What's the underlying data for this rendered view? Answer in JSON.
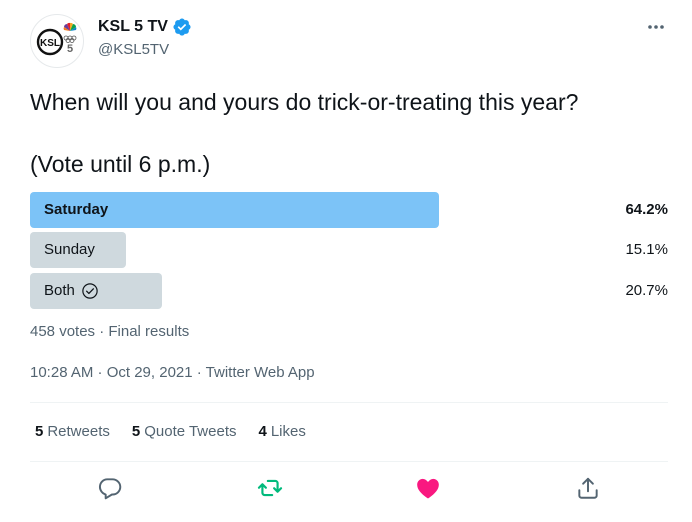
{
  "account": {
    "display_name": "KSL 5 TV",
    "handle": "@KSL5TV",
    "avatar_text": "KSL",
    "verified": true
  },
  "tweet": {
    "text_line1": "When will you and yours do trick-or-treating this year?",
    "text_line2": "(Vote until 6 p.m.)"
  },
  "poll": {
    "options": [
      {
        "label": "Saturday",
        "percent_label": "64.2%",
        "percent": 64.2,
        "winner": true,
        "selected": false
      },
      {
        "label": "Sunday",
        "percent_label": "15.1%",
        "percent": 15.1,
        "winner": false,
        "selected": false
      },
      {
        "label": "Both",
        "percent_label": "20.7%",
        "percent": 20.7,
        "winner": false,
        "selected": true
      }
    ],
    "meta": "458 votes · Final results"
  },
  "timestamp": "10:28 AM · Oct 29, 2021 · Twitter Web App",
  "stats": {
    "retweets_count": "5",
    "retweets_label": "Retweets",
    "quotes_count": "5",
    "quotes_label": "Quote Tweets",
    "likes_count": "4",
    "likes_label": "Likes"
  },
  "colors": {
    "winner_bar": "#7cc3f7",
    "loser_bar": "#cfd9de",
    "verified": "#1d9bf0",
    "retweet_icon": "#00ba7c",
    "like_icon": "#f91880",
    "secondary_text": "#536471"
  },
  "icons": {
    "more": "more-icon",
    "verified": "verified-badge-icon",
    "selected_choice": "check-circle-icon",
    "reply": "reply-icon",
    "retweet": "retweet-icon",
    "like": "heart-icon",
    "share": "share-icon"
  }
}
